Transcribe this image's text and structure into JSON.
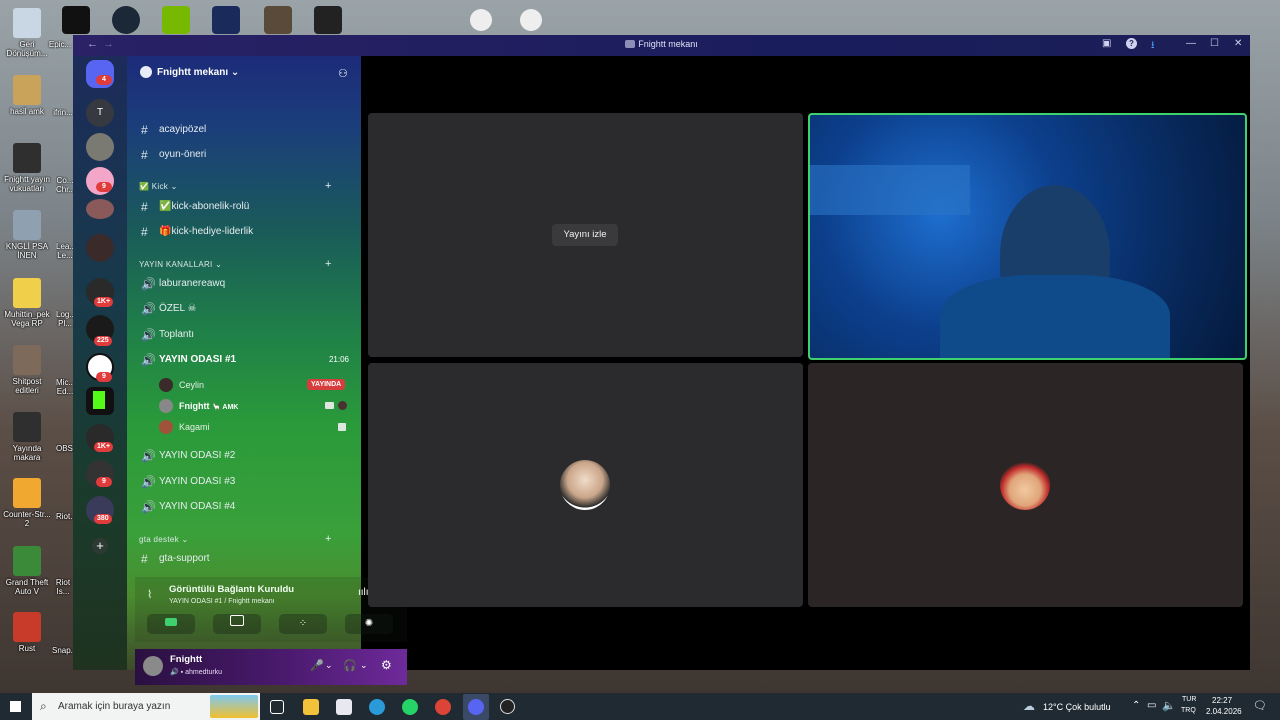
{
  "desktop": {
    "icons": [
      {
        "label": "Geri Dönüşüm...",
        "color": "#c9d6e3"
      },
      {
        "label": "hasil amk",
        "color": "#caa35a"
      },
      {
        "label": "Fnightt yayın vukuatları",
        "color": "#2f2f2f"
      },
      {
        "label": "KNGLİ PSA İNEN",
        "color": "#8fa0b0"
      },
      {
        "label": "Muhittin_pek Vega RP",
        "color": "#f0d04a"
      },
      {
        "label": "Shitpost editleri",
        "color": "#7e6a5a"
      },
      {
        "label": "Yayında makara",
        "color": "#2f2f2f"
      },
      {
        "label": "Counter-Str... 2",
        "color": "#f0a830"
      },
      {
        "label": "Grand Theft Auto V",
        "color": "#3a8a3a"
      },
      {
        "label": "Rust",
        "color": "#c83a2a"
      }
    ],
    "second_col": [
      "Epic...",
      "ifrin...",
      "Co... Chr...",
      "Lea... Le...",
      "Log... Pl...",
      "Mic... Ed...",
      "OBS...",
      "Riot...",
      "Riot Is...",
      "Snap..."
    ]
  },
  "window": {
    "title": "Fnightt mekanı",
    "nav_back": "←",
    "nav_forward": "→",
    "ctrl_screen": "▣",
    "ctrl_help": "?",
    "ctrl_download": "⭳",
    "ctrl_min": "—",
    "ctrl_max": "☐",
    "ctrl_close": "✕"
  },
  "rail": {
    "home_badge": "4",
    "letter_server": "T",
    "badges": [
      "9",
      "1K+",
      "225",
      "9",
      "1K+",
      "9",
      "380"
    ]
  },
  "server": {
    "name": "Fnightt mekanı",
    "name_chevron": "⌄"
  },
  "channels": {
    "text_top": [
      {
        "name": "acayipözel"
      },
      {
        "name": "oyun-öneri"
      }
    ],
    "kick_category": "✅ Kick",
    "kick_channels": [
      {
        "name": "✅kick-abonelik-rolü"
      },
      {
        "name": "🎁kick-hediye-liderlik"
      }
    ],
    "yayin_category": "YAYIN KANALLARI",
    "voice": [
      {
        "name": "laburanereawq"
      },
      {
        "name": "ÖZEL ☠"
      },
      {
        "name": "Toplantı"
      }
    ],
    "active_voice": {
      "name": "YAYIN ODASI #1",
      "timer": "21:06"
    },
    "voice_users": [
      {
        "name": "Ceylin"
      },
      {
        "name": "Fnightt",
        "tag": "🦙 AMK"
      },
      {
        "name": "Kagami"
      }
    ],
    "live_badge": "YAYINDA",
    "more_voice": [
      {
        "name": "YAYIN ODASI #2"
      },
      {
        "name": "YAYIN ODASI #3"
      },
      {
        "name": "YAYIN ODASI #4"
      }
    ],
    "gta_category": "gta destek",
    "gta_channel": "gta-support"
  },
  "voice_panel": {
    "status": "Görüntülü Bağlantı Kuruldu",
    "location": "YAYIN ODASI #1 / Fnightt mekanı"
  },
  "user_panel": {
    "name": "Fnightt",
    "subtitle": "ahmedturku"
  },
  "stage": {
    "watch_button": "Yayını izle"
  },
  "taskbar": {
    "search_placeholder": "Aramak için buraya yazın",
    "weather": "12°C  Çok bulutlu",
    "lang_top": "TUR",
    "lang_bottom": "TRQ",
    "time": "22:27",
    "date": "2.04.2026"
  }
}
